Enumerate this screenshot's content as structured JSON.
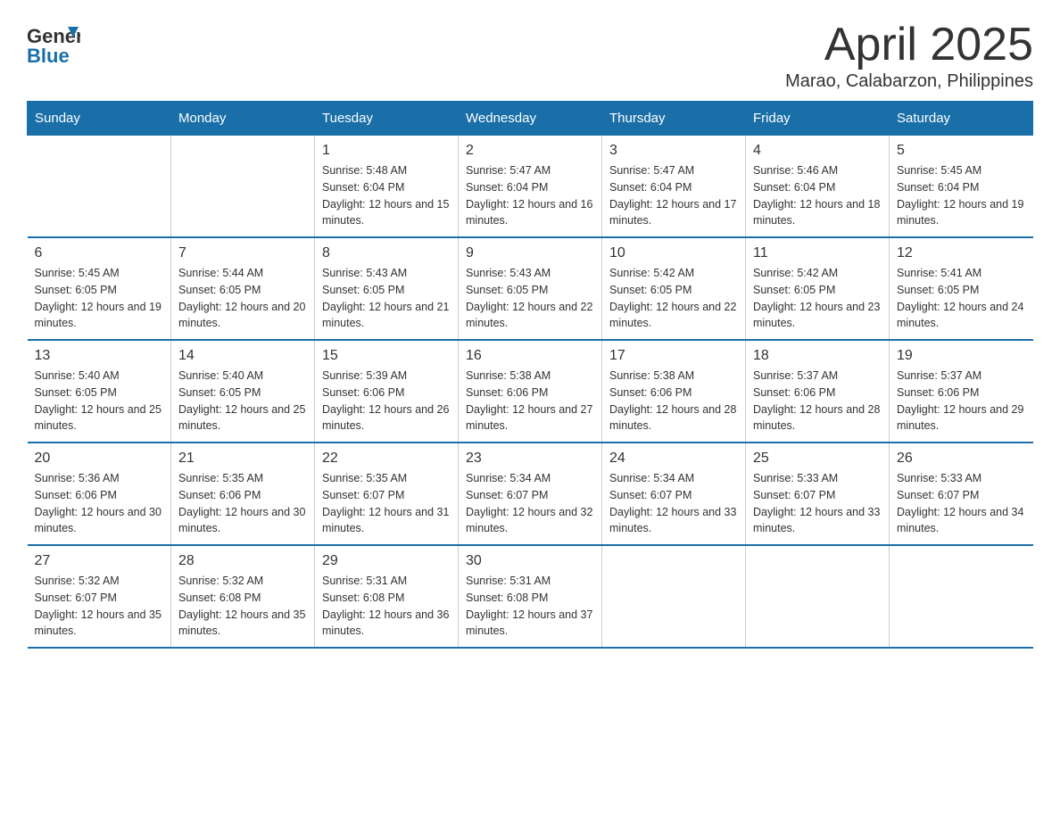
{
  "header": {
    "logo_general": "General",
    "logo_blue": "Blue",
    "title": "April 2025",
    "subtitle": "Marao, Calabarzon, Philippines"
  },
  "days_of_week": [
    "Sunday",
    "Monday",
    "Tuesday",
    "Wednesday",
    "Thursday",
    "Friday",
    "Saturday"
  ],
  "weeks": [
    [
      {
        "day": "",
        "sunrise": "",
        "sunset": "",
        "daylight": ""
      },
      {
        "day": "",
        "sunrise": "",
        "sunset": "",
        "daylight": ""
      },
      {
        "day": "1",
        "sunrise": "Sunrise: 5:48 AM",
        "sunset": "Sunset: 6:04 PM",
        "daylight": "Daylight: 12 hours and 15 minutes."
      },
      {
        "day": "2",
        "sunrise": "Sunrise: 5:47 AM",
        "sunset": "Sunset: 6:04 PM",
        "daylight": "Daylight: 12 hours and 16 minutes."
      },
      {
        "day": "3",
        "sunrise": "Sunrise: 5:47 AM",
        "sunset": "Sunset: 6:04 PM",
        "daylight": "Daylight: 12 hours and 17 minutes."
      },
      {
        "day": "4",
        "sunrise": "Sunrise: 5:46 AM",
        "sunset": "Sunset: 6:04 PM",
        "daylight": "Daylight: 12 hours and 18 minutes."
      },
      {
        "day": "5",
        "sunrise": "Sunrise: 5:45 AM",
        "sunset": "Sunset: 6:04 PM",
        "daylight": "Daylight: 12 hours and 19 minutes."
      }
    ],
    [
      {
        "day": "6",
        "sunrise": "Sunrise: 5:45 AM",
        "sunset": "Sunset: 6:05 PM",
        "daylight": "Daylight: 12 hours and 19 minutes."
      },
      {
        "day": "7",
        "sunrise": "Sunrise: 5:44 AM",
        "sunset": "Sunset: 6:05 PM",
        "daylight": "Daylight: 12 hours and 20 minutes."
      },
      {
        "day": "8",
        "sunrise": "Sunrise: 5:43 AM",
        "sunset": "Sunset: 6:05 PM",
        "daylight": "Daylight: 12 hours and 21 minutes."
      },
      {
        "day": "9",
        "sunrise": "Sunrise: 5:43 AM",
        "sunset": "Sunset: 6:05 PM",
        "daylight": "Daylight: 12 hours and 22 minutes."
      },
      {
        "day": "10",
        "sunrise": "Sunrise: 5:42 AM",
        "sunset": "Sunset: 6:05 PM",
        "daylight": "Daylight: 12 hours and 22 minutes."
      },
      {
        "day": "11",
        "sunrise": "Sunrise: 5:42 AM",
        "sunset": "Sunset: 6:05 PM",
        "daylight": "Daylight: 12 hours and 23 minutes."
      },
      {
        "day": "12",
        "sunrise": "Sunrise: 5:41 AM",
        "sunset": "Sunset: 6:05 PM",
        "daylight": "Daylight: 12 hours and 24 minutes."
      }
    ],
    [
      {
        "day": "13",
        "sunrise": "Sunrise: 5:40 AM",
        "sunset": "Sunset: 6:05 PM",
        "daylight": "Daylight: 12 hours and 25 minutes."
      },
      {
        "day": "14",
        "sunrise": "Sunrise: 5:40 AM",
        "sunset": "Sunset: 6:05 PM",
        "daylight": "Daylight: 12 hours and 25 minutes."
      },
      {
        "day": "15",
        "sunrise": "Sunrise: 5:39 AM",
        "sunset": "Sunset: 6:06 PM",
        "daylight": "Daylight: 12 hours and 26 minutes."
      },
      {
        "day": "16",
        "sunrise": "Sunrise: 5:38 AM",
        "sunset": "Sunset: 6:06 PM",
        "daylight": "Daylight: 12 hours and 27 minutes."
      },
      {
        "day": "17",
        "sunrise": "Sunrise: 5:38 AM",
        "sunset": "Sunset: 6:06 PM",
        "daylight": "Daylight: 12 hours and 28 minutes."
      },
      {
        "day": "18",
        "sunrise": "Sunrise: 5:37 AM",
        "sunset": "Sunset: 6:06 PM",
        "daylight": "Daylight: 12 hours and 28 minutes."
      },
      {
        "day": "19",
        "sunrise": "Sunrise: 5:37 AM",
        "sunset": "Sunset: 6:06 PM",
        "daylight": "Daylight: 12 hours and 29 minutes."
      }
    ],
    [
      {
        "day": "20",
        "sunrise": "Sunrise: 5:36 AM",
        "sunset": "Sunset: 6:06 PM",
        "daylight": "Daylight: 12 hours and 30 minutes."
      },
      {
        "day": "21",
        "sunrise": "Sunrise: 5:35 AM",
        "sunset": "Sunset: 6:06 PM",
        "daylight": "Daylight: 12 hours and 30 minutes."
      },
      {
        "day": "22",
        "sunrise": "Sunrise: 5:35 AM",
        "sunset": "Sunset: 6:07 PM",
        "daylight": "Daylight: 12 hours and 31 minutes."
      },
      {
        "day": "23",
        "sunrise": "Sunrise: 5:34 AM",
        "sunset": "Sunset: 6:07 PM",
        "daylight": "Daylight: 12 hours and 32 minutes."
      },
      {
        "day": "24",
        "sunrise": "Sunrise: 5:34 AM",
        "sunset": "Sunset: 6:07 PM",
        "daylight": "Daylight: 12 hours and 33 minutes."
      },
      {
        "day": "25",
        "sunrise": "Sunrise: 5:33 AM",
        "sunset": "Sunset: 6:07 PM",
        "daylight": "Daylight: 12 hours and 33 minutes."
      },
      {
        "day": "26",
        "sunrise": "Sunrise: 5:33 AM",
        "sunset": "Sunset: 6:07 PM",
        "daylight": "Daylight: 12 hours and 34 minutes."
      }
    ],
    [
      {
        "day": "27",
        "sunrise": "Sunrise: 5:32 AM",
        "sunset": "Sunset: 6:07 PM",
        "daylight": "Daylight: 12 hours and 35 minutes."
      },
      {
        "day": "28",
        "sunrise": "Sunrise: 5:32 AM",
        "sunset": "Sunset: 6:08 PM",
        "daylight": "Daylight: 12 hours and 35 minutes."
      },
      {
        "day": "29",
        "sunrise": "Sunrise: 5:31 AM",
        "sunset": "Sunset: 6:08 PM",
        "daylight": "Daylight: 12 hours and 36 minutes."
      },
      {
        "day": "30",
        "sunrise": "Sunrise: 5:31 AM",
        "sunset": "Sunset: 6:08 PM",
        "daylight": "Daylight: 12 hours and 37 minutes."
      },
      {
        "day": "",
        "sunrise": "",
        "sunset": "",
        "daylight": ""
      },
      {
        "day": "",
        "sunrise": "",
        "sunset": "",
        "daylight": ""
      },
      {
        "day": "",
        "sunrise": "",
        "sunset": "",
        "daylight": ""
      }
    ]
  ]
}
